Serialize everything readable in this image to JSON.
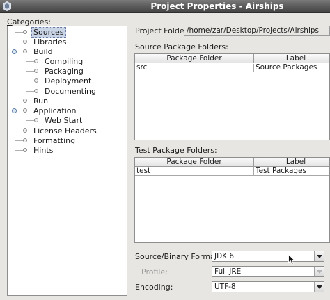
{
  "window": {
    "title": "Project Properties - Airships"
  },
  "categories": {
    "label": "Categories:",
    "items": [
      {
        "label": "Sources",
        "level": 0,
        "selected": true
      },
      {
        "label": "Libraries",
        "level": 0
      },
      {
        "label": "Build",
        "level": 0,
        "expanded": true
      },
      {
        "label": "Compiling",
        "level": 1
      },
      {
        "label": "Packaging",
        "level": 1
      },
      {
        "label": "Deployment",
        "level": 1
      },
      {
        "label": "Documenting",
        "level": 1
      },
      {
        "label": "Run",
        "level": 0
      },
      {
        "label": "Application",
        "level": 0,
        "expanded": true
      },
      {
        "label": "Web Start",
        "level": 1
      },
      {
        "label": "License Headers",
        "level": 0
      },
      {
        "label": "Formatting",
        "level": 0
      },
      {
        "label": "Hints",
        "level": 0
      }
    ]
  },
  "project_folder": {
    "label": "Project Folder:",
    "value": "/home/zar/Desktop/Projects/Airships"
  },
  "source_folders": {
    "label": "Source Package Folders:",
    "columns": [
      "Package Folder",
      "Label"
    ],
    "rows": [
      {
        "folder": "src",
        "label": "Source Packages"
      }
    ]
  },
  "test_folders": {
    "label": "Test Package Folders:",
    "columns": [
      "Package Folder",
      "Label"
    ],
    "rows": [
      {
        "folder": "test",
        "label": "Test Packages"
      }
    ]
  },
  "format": {
    "label": "Source/Binary Format:",
    "value": "JDK 6"
  },
  "profile": {
    "label": "Profile:",
    "value": "Full JRE",
    "enabled": false
  },
  "encoding": {
    "label": "Encoding:",
    "value": "UTF-8"
  }
}
